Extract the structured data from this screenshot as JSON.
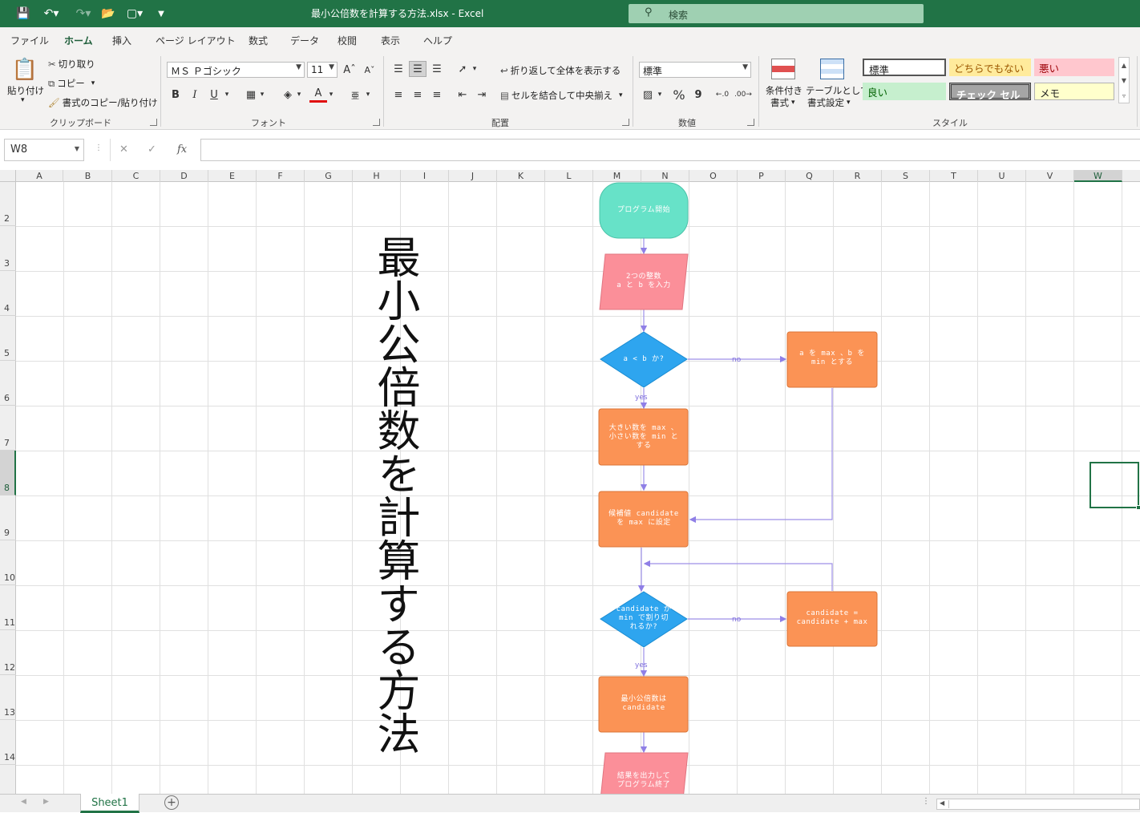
{
  "window": {
    "title": "最小公倍数を計算する方法.xlsx  -  Excel",
    "search_placeholder": "検索",
    "accent_color": "#217346"
  },
  "quick_access": [
    "save-icon",
    "undo-icon",
    "redo-icon",
    "open-icon",
    "touch-mode-icon",
    "customize-icon"
  ],
  "ribbon_tabs": [
    "ファイル",
    "ホーム",
    "挿入",
    "ページ レイアウト",
    "数式",
    "データ",
    "校閲",
    "表示",
    "ヘルプ"
  ],
  "active_tab": "ホーム",
  "clipboard": {
    "paste": "貼り付け",
    "cut": "切り取り",
    "copy": "コピー",
    "format_painter": "書式のコピー/貼り付け",
    "label": "クリップボード"
  },
  "font": {
    "name": "ＭＳ Ｐゴシック",
    "size": "11",
    "bold": "B",
    "italic": "I",
    "underline": "U",
    "font_color": "A",
    "label": "フォント"
  },
  "alignment": {
    "wrap": "折り返して全体を表示する",
    "merge": "セルを結合して中央揃え",
    "label": "配置"
  },
  "number": {
    "format": "標準",
    "percent": "%",
    "comma": "9",
    "label": "数値"
  },
  "styles": {
    "conditional": "条件付き",
    "conditional2": "書式",
    "table": "テーブルとして",
    "table2": "書式設定",
    "cells": [
      "標準",
      "どちらでもない",
      "悪い",
      "良い",
      "チェック セル",
      "メモ"
    ],
    "label": "スタイル"
  },
  "formula_bar": {
    "name_box": "W8",
    "fx": "fx",
    "value": ""
  },
  "columns": [
    "A",
    "B",
    "C",
    "D",
    "E",
    "F",
    "G",
    "H",
    "I",
    "J",
    "K",
    "L",
    "M",
    "N",
    "O",
    "P",
    "Q",
    "R",
    "S",
    "T",
    "U",
    "V",
    "W"
  ],
  "selected_column": "W",
  "rows": [
    "2",
    "3",
    "4",
    "5",
    "6",
    "7",
    "8",
    "9",
    "10",
    "11",
    "12",
    "13",
    "14"
  ],
  "selected_row": "8",
  "sheet_title": "最小公倍数を計算する方法",
  "flowchart": {
    "start": "プログラム開始",
    "input": [
      "2つの整数",
      "a と b を入力"
    ],
    "decision1": "a < b か?",
    "swap": [
      "a を max 、b を",
      "min とする"
    ],
    "assign": [
      "大きい数を max 、",
      "小さい数を min と",
      "する"
    ],
    "candidate": [
      "候補値 candidate",
      "を max に設定"
    ],
    "decision2": [
      "candidate が",
      "min で割り切",
      "れるか?"
    ],
    "increment": [
      "candidate =",
      "candidate + max"
    ],
    "result": [
      "最小公倍数は",
      "candidate"
    ],
    "end": [
      "結果を出力して",
      "プログラム終了"
    ],
    "yes": "yes",
    "no": "no"
  },
  "sheet_tabs": [
    "Sheet1"
  ]
}
